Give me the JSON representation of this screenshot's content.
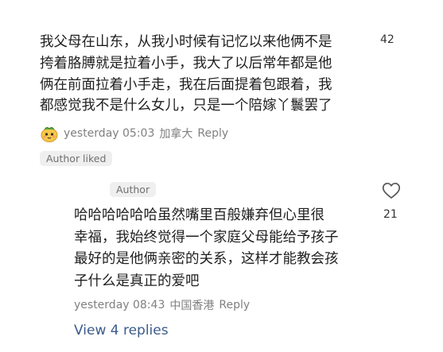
{
  "comment": {
    "lines": [
      "我父母在山东，从我小时候有记忆以来他俩不是",
      "挎着胳膊就是拉着小手，我大了以后常年都是他",
      "俩在前面拉着小手走，我在后面提着包跟着，我",
      "都感觉我不是什么女儿，只是一个陪嫁丫鬟罢了"
    ],
    "likes": "42",
    "time": "yesterday 05:03",
    "location": "加拿大",
    "reply_label": "Reply",
    "author_liked": "Author liked",
    "avatar_icon": "sticker-avatar-icon"
  },
  "reply": {
    "author_tag": "Author",
    "lines": [
      "哈哈哈哈哈哈虽然嘴里百般嫌弃但心里很",
      "幸福，我始终觉得一个家庭父母能给予孩子",
      "最好的是他俩亲密的关系，这样才能教会孩",
      "子什么是真正的爱吧"
    ],
    "likes": "21",
    "time": "yesterday 08:43",
    "location": "中国香港",
    "reply_label": "Reply",
    "like_icon": "heart-outline-icon"
  },
  "view_replies": "View 4 replies"
}
